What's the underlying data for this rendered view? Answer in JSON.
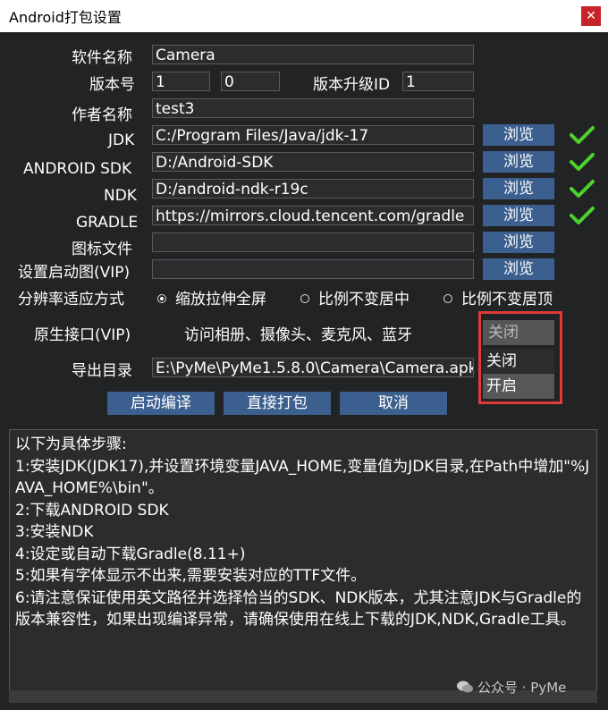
{
  "window": {
    "title": "Android打包设置"
  },
  "form": {
    "app_name": {
      "label": "软件名称",
      "value": "Camera"
    },
    "version": {
      "label": "版本号",
      "major": "1",
      "minor": "0"
    },
    "upgrade_id": {
      "label": "版本升级ID",
      "value": "1"
    },
    "author": {
      "label": "作者名称",
      "value": "test3"
    },
    "jdk": {
      "label": "JDK",
      "value": "C:/Program Files/Java/jdk-17"
    },
    "android_sdk": {
      "label": "ANDROID SDK",
      "value": "D:/Android-SDK"
    },
    "ndk": {
      "label": "NDK",
      "value": "D:/android-ndk-r19c"
    },
    "gradle": {
      "label": "GRADLE",
      "value": "https://mirrors.cloud.tencent.com/gradle"
    },
    "icon_file": {
      "label": "图标文件",
      "value": ""
    },
    "splash": {
      "label": "设置启动图(VIP)",
      "value": ""
    },
    "browse_label": "浏览",
    "resolution": {
      "label": "分辨率适应方式",
      "options": [
        "缩放拉伸全屏",
        "比例不变居中",
        "比例不变居顶"
      ],
      "selected": 0
    },
    "native": {
      "label": "原生接口(VIP)",
      "desc": "访问相册、摄像头、麦克风、蓝牙",
      "selected": "关闭",
      "options": [
        "关闭",
        "开启"
      ]
    },
    "export_dir": {
      "label": "导出目录",
      "value": "E:\\PyMe\\PyMe1.5.8.0\\Camera\\Camera.apk"
    }
  },
  "actions": {
    "compile": "启动编译",
    "package": "直接打包",
    "cancel": "取消"
  },
  "steps": [
    "以下为具体步骤:",
    "1:安装JDK(JDK17),并设置环境变量JAVA_HOME,变量值为JDK目录,在Path中增加\"%JAVA_HOME%\\bin\"。",
    "2:下载ANDROID SDK",
    "3:安装NDK",
    "4:设定或自动下载Gradle(8.11+)",
    "5:如果有字体显示不出来,需要安装对应的TTF文件。",
    "6:请注意保证使用英文路径并选择恰当的SDK、NDK版本，尤其注意JDK与Gradle的版本兼容性，如果出现编译异常，请确保使用在线上下载的JDK,NDK,Gradle工具。"
  ],
  "watermark": "公众号 · PyMe",
  "colors": {
    "accent": "#3b5f8e",
    "check": "#4cd42a",
    "highlight": "#e03a3a"
  }
}
